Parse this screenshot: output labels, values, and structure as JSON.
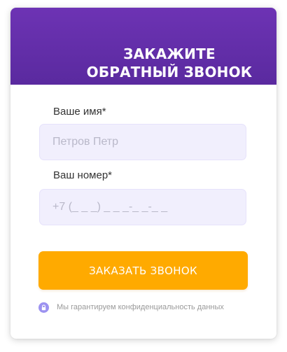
{
  "header": {
    "title_line1": "ЗАКАЖИТЕ",
    "title_line2": "ОБРАТНЫЙ ЗВОНОК"
  },
  "form": {
    "name_label": "Ваше имя*",
    "name_placeholder": "Петров Петр",
    "phone_label": "Ваш номер*",
    "phone_placeholder": "+7 (_ _ _) _ _ _-_ _-_ _",
    "submit_label": "ЗАКАЗАТЬ ЗВОНОК",
    "privacy_text": "Мы гарантируем конфиденциальность данных"
  },
  "icons": {
    "privacy": "lock-icon"
  },
  "colors": {
    "header": "#5f2ca6",
    "button": "#ffaa00",
    "input_bg": "#f1effd",
    "lock_badge": "#9c92f0"
  }
}
